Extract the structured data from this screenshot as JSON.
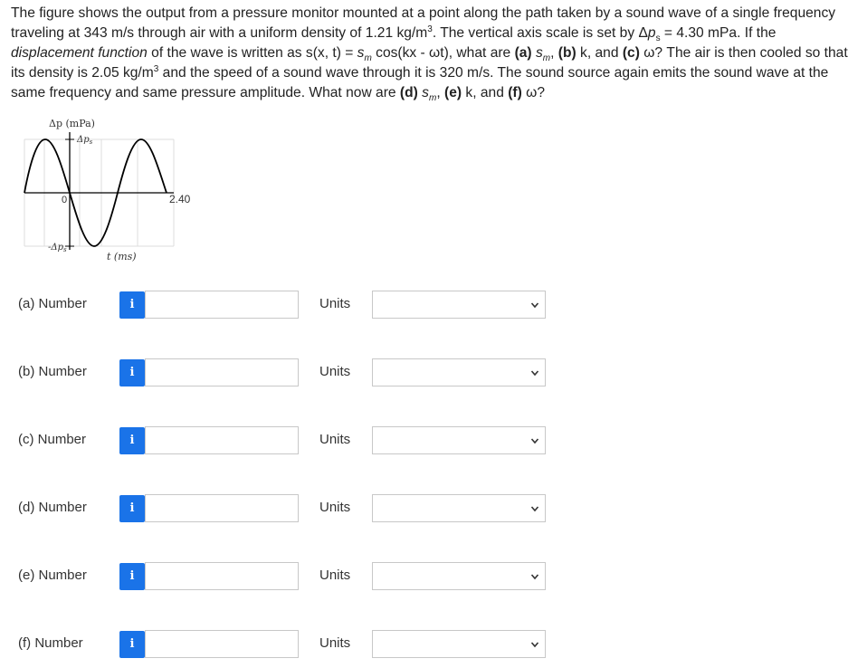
{
  "problem": {
    "p1": "The figure shows the output from a pressure monitor mounted at a point along the path taken by a sound wave of a single frequency traveling at 343 m/s through air with a uniform density of 1.21 kg/m",
    "p2": ". The vertical axis scale is set by Δ",
    "p3": " = 4.30 mPa. If the ",
    "p4": "displacement function",
    "p5": " of the wave is written as s(x, t) = ",
    "p6": " cos(kx - ωt), what are ",
    "p7": "(a)",
    "p8": " s",
    "p9": ", ",
    "p10": "(b)",
    "p11": " k, and ",
    "p12": "(c)",
    "p13": " ω? The air is then cooled so that its density is 2.05 kg/m",
    "p14": " and the speed of a sound wave through it is 320 m/s. The sound source again emits the sound wave at the same frequency and same pressure amplitude. What now are ",
    "p15": "(d)",
    "p16": " s",
    "p17": ", ",
    "p18": "(e)",
    "p19": " k, and ",
    "p20": "(f)",
    "p21": " ω?",
    "sup3": "3",
    "sub_s": "s",
    "sm": "s",
    "sub_m": "m"
  },
  "figure": {
    "y_axis_label": "Δp (mPa)",
    "top_tick_label": "Δp",
    "top_tick_sub": "s",
    "bottom_tick_label": "-Δp",
    "bottom_tick_sub": "s",
    "origin_label": "0",
    "t_end_label": "2.40",
    "x_axis_label": "t (ms)"
  },
  "questions": [
    {
      "label": "(a)  Number",
      "units_label": "Units",
      "info": "i",
      "value": "",
      "unit": ""
    },
    {
      "label": "(b)  Number",
      "units_label": "Units",
      "info": "i",
      "value": "",
      "unit": ""
    },
    {
      "label": "(c)  Number",
      "units_label": "Units",
      "info": "i",
      "value": "",
      "unit": ""
    },
    {
      "label": "(d)  Number",
      "units_label": "Units",
      "info": "i",
      "value": "",
      "unit": ""
    },
    {
      "label": "(e)  Number",
      "units_label": "Units",
      "info": "i",
      "value": "",
      "unit": ""
    },
    {
      "label": "(f)  Number",
      "units_label": "Units",
      "info": "i",
      "value": "",
      "unit": ""
    }
  ],
  "colors": {
    "info_button": "#1a73e8",
    "input_border": "#c8c8c8"
  },
  "icons": {
    "info": "info-icon",
    "dropdown": "chevron-down-icon"
  }
}
